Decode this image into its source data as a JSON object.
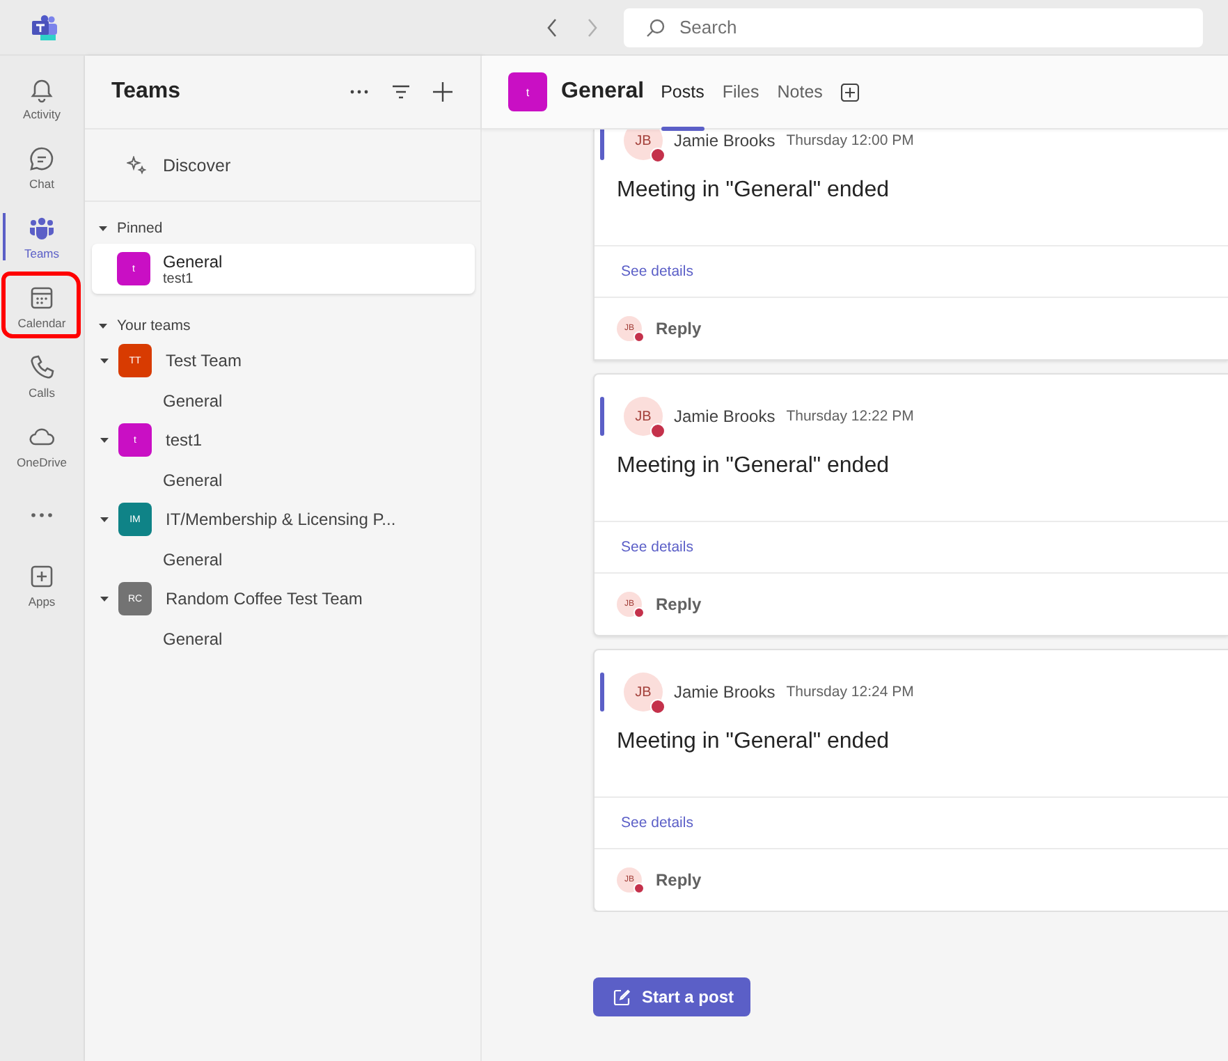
{
  "top_bar": {
    "search": {
      "placeholder": "Search"
    }
  },
  "rail": [
    {
      "kind": "bell",
      "label": "Activity",
      "selected": false,
      "annotated": false
    },
    {
      "kind": "chat",
      "label": "Chat",
      "selected": false,
      "annotated": false
    },
    {
      "kind": "teams",
      "label": "Teams",
      "selected": true,
      "annotated": false
    },
    {
      "kind": "calendar",
      "label": "Calendar",
      "selected": false,
      "annotated": true
    },
    {
      "kind": "phone",
      "label": "Calls",
      "selected": false,
      "annotated": false
    },
    {
      "kind": "cloud",
      "label": "OneDrive",
      "selected": false,
      "annotated": false
    },
    {
      "kind": "more",
      "selected": false,
      "annotated": false
    },
    {
      "kind": "apps",
      "label": "Apps",
      "selected": false,
      "annotated": false
    }
  ],
  "teams_panel": {
    "title": "Teams",
    "discover": "Discover",
    "pinned": {
      "label": "Pinned",
      "expanded": true,
      "channels": [
        {
          "name": "General",
          "team": "test1",
          "avatar": "t",
          "color": "#c90fc4",
          "selected": true
        }
      ]
    },
    "your_teams": {
      "label": "Your teams",
      "expanded": true,
      "teams": [
        {
          "name": "Test Team",
          "avatar": "TT",
          "color": "#d83b01",
          "expanded": true,
          "channels": [
            {
              "name": "General",
              "selected": false
            }
          ]
        },
        {
          "name": "test1",
          "avatar": "t",
          "color": "#c90fc4",
          "expanded": true,
          "channels": [
            {
              "name": "General",
              "selected": false
            }
          ]
        },
        {
          "name": "IT/Membership & Licensing P...",
          "avatar": "IM",
          "color": "#0f8387",
          "expanded": true,
          "channels": [
            {
              "name": "General",
              "selected": false
            }
          ]
        },
        {
          "name": "Random Coffee Test Team",
          "avatar": "RC",
          "color": "#737373",
          "expanded": true,
          "channels": [
            {
              "name": "General",
              "selected": false
            }
          ]
        }
      ]
    }
  },
  "channel": {
    "avatar": "t",
    "color": "#c90fc4",
    "name": "General",
    "tabs": [
      {
        "label": "Posts",
        "selected": true
      },
      {
        "label": "Files",
        "selected": false
      },
      {
        "label": "Notes",
        "selected": false
      }
    ],
    "posts": [
      {
        "author": "Jamie Brooks",
        "initials": "JB",
        "busy": true,
        "time": "Thursday 12:00 PM",
        "message": "Meeting in \"General\" ended",
        "link": "See details",
        "reply_initials": "JB",
        "reply": "Reply"
      },
      {
        "author": "Jamie Brooks",
        "initials": "JB",
        "busy": true,
        "time": "Thursday 12:22 PM",
        "message": "Meeting in \"General\" ended",
        "link": "See details",
        "reply_initials": "JB",
        "reply": "Reply"
      },
      {
        "author": "Jamie Brooks",
        "initials": "JB",
        "busy": true,
        "time": "Thursday 12:24 PM",
        "message": "Meeting in \"General\" ended",
        "link": "See details",
        "reply_initials": "JB",
        "reply": "Reply"
      }
    ],
    "start_post": "Start a post"
  }
}
